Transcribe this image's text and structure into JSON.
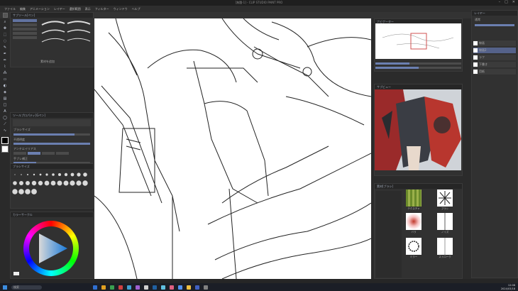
{
  "titlebar": {
    "title": "[無題-1] - CLIP STUDIO PAINT PRO"
  },
  "menu": {
    "items": [
      "ファイル",
      "編集",
      "アニメーション",
      "レイヤー",
      "選択範囲",
      "表示",
      "フィルター",
      "ウィンドウ",
      "ヘルプ"
    ]
  },
  "window_controls": {
    "minimize": "–",
    "maximize": "□",
    "close": "✕"
  },
  "sub_tool_panel": {
    "title": "サブツール[ペン]",
    "brushes": [
      "Gペン",
      "丸ペン",
      "カブラペン",
      "ミリペン",
      "リアルGペン"
    ],
    "material_link": "素材を追加"
  },
  "tool_property": {
    "title": "ツールプロパティ[Gペン]",
    "rows": [
      "ブラシサイズ",
      "不透明度",
      "アンチエイリアス",
      "手ブレ補正"
    ]
  },
  "brush_size_panel": {
    "title": "ブラシサイズ"
  },
  "color_wheel_panel": {
    "title": "カラーサークル"
  },
  "navigator": {
    "title": "ナビゲーター"
  },
  "reference": {
    "title": "サブビュー"
  },
  "material_panel": {
    "title": "素材[ブラシ]",
    "items": [
      "テクスチャ",
      "ブラシ",
      "バラ",
      "ノイズ",
      "ミラー",
      "ストローク"
    ]
  },
  "layer_panel": {
    "title": "レイヤー",
    "blend_mode": "通常",
    "layers": [
      "線画",
      "線画2",
      "ラフ",
      "下書き",
      "用紙"
    ]
  },
  "taskbar": {
    "search_placeholder": "検索",
    "time": "12:08",
    "date": "2024/03/18"
  },
  "colors": {
    "accent": "#6b7fb0",
    "panel": "#313131",
    "canvas": "#ffffff"
  }
}
